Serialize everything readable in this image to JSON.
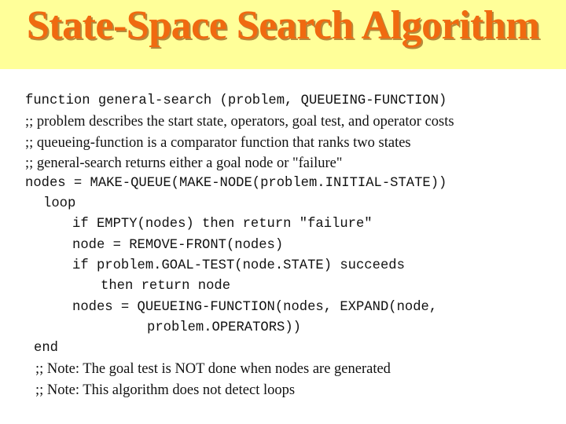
{
  "slide": {
    "title": "State-Space Search Algorithm",
    "colors": {
      "header_background": "#FFFF99",
      "title_color": "#F06A10",
      "title_shadow": "#B58A3C",
      "body_text": "#111111"
    },
    "lines": [
      {
        "kind": "code",
        "indent": 0,
        "text": "function general-search (problem, QUEUEING-FUNCTION)"
      },
      {
        "kind": "comment",
        "indent": 0,
        "text": ";; problem describes the start state, operators, goal test, and operator costs"
      },
      {
        "kind": "comment",
        "indent": 0,
        "text": ";; queueing-function is a comparator function that ranks two states"
      },
      {
        "kind": "comment",
        "indent": 0,
        "text": ";; general-search returns either a goal node or \"failure\""
      },
      {
        "kind": "code",
        "indent": 0,
        "text": "nodes = MAKE-QUEUE(MAKE-NODE(problem.INITIAL-STATE))"
      },
      {
        "kind": "code",
        "indent": 1,
        "text": "loop"
      },
      {
        "kind": "code",
        "indent": 2,
        "text": "if EMPTY(nodes) then return \"failure\""
      },
      {
        "kind": "code",
        "indent": 2,
        "text": "node = REMOVE-FRONT(nodes)"
      },
      {
        "kind": "code",
        "indent": 2,
        "text": "if problem.GOAL-TEST(node.STATE) succeeds"
      },
      {
        "kind": "code",
        "indent": 3,
        "text": "then return node"
      },
      {
        "kind": "code",
        "indent": 2,
        "text": "nodes = QUEUEING-FUNCTION(nodes, EXPAND(node,"
      },
      {
        "kind": "code",
        "indent": 4,
        "text": "problem.OPERATORS))"
      },
      {
        "kind": "code",
        "indent": 0,
        "text": "end"
      },
      {
        "kind": "comment",
        "indent": 0,
        "text": ";; Note: The goal test is NOT done when nodes are generated"
      },
      {
        "kind": "comment",
        "indent": 0,
        "text": ";; Note: This algorithm does not detect loops"
      }
    ]
  }
}
